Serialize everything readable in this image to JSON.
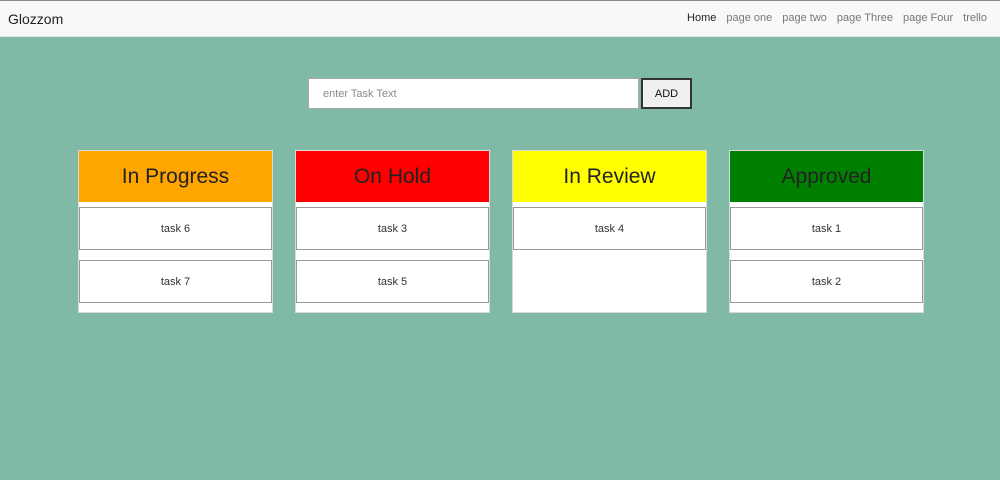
{
  "navbar": {
    "brand": "Glozzom",
    "links": [
      "Home",
      "page one",
      "page two",
      "page Three",
      "page Four",
      "trello"
    ],
    "active": "Home"
  },
  "task_form": {
    "placeholder": "enter Task Text",
    "value": "",
    "add_label": "ADD"
  },
  "columns": [
    {
      "title": "In Progress",
      "color": "#ffa500",
      "tasks": [
        "task 6",
        "task 7"
      ]
    },
    {
      "title": "On Hold",
      "color": "#ff0000",
      "tasks": [
        "task 3",
        "task 5"
      ]
    },
    {
      "title": "In Review",
      "color": "#ffff00",
      "tasks": [
        "task 4"
      ]
    },
    {
      "title": "Approved",
      "color": "#008000",
      "tasks": [
        "task 1",
        "task 2"
      ]
    }
  ],
  "colors": {
    "page_background": "#80b9a6",
    "navbar_background": "#f8f8f8"
  }
}
